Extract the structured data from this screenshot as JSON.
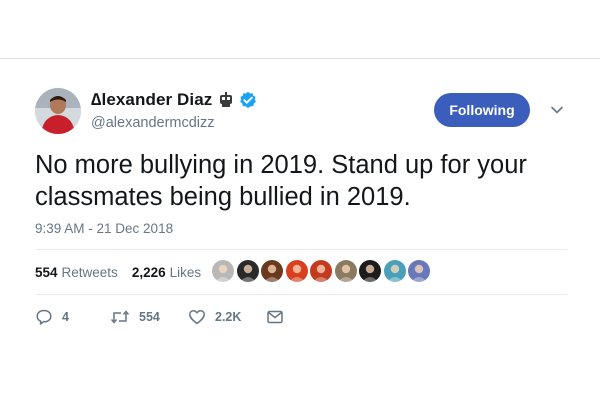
{
  "tweet": {
    "author_name": "∆lexander Diaz",
    "handle": "@alexandermcdizz",
    "follow_label": "Following",
    "text": "No more bullying in 2019. Stand up for your classmates being bullied in 2019.",
    "timestamp": "9:39 AM - 21 Dec 2018",
    "retweets_count": "554",
    "retweets_label": "Retweets",
    "likes_count": "2,226",
    "likes_label": "Likes"
  },
  "actions": {
    "reply_count": "4",
    "retweet_count": "554",
    "like_count": "2.2K"
  },
  "colors": {
    "follow_button": "#3b5ebd",
    "verified": "#1da1f2",
    "secondary_text": "#657786"
  },
  "liker_avatars": [
    "#b8b8b8",
    "#2a2a2a",
    "#6b3a1e",
    "#d94020",
    "#c23b1f",
    "#8a7a60",
    "#1c1c1c",
    "#4aa0b8",
    "#6878b8"
  ]
}
